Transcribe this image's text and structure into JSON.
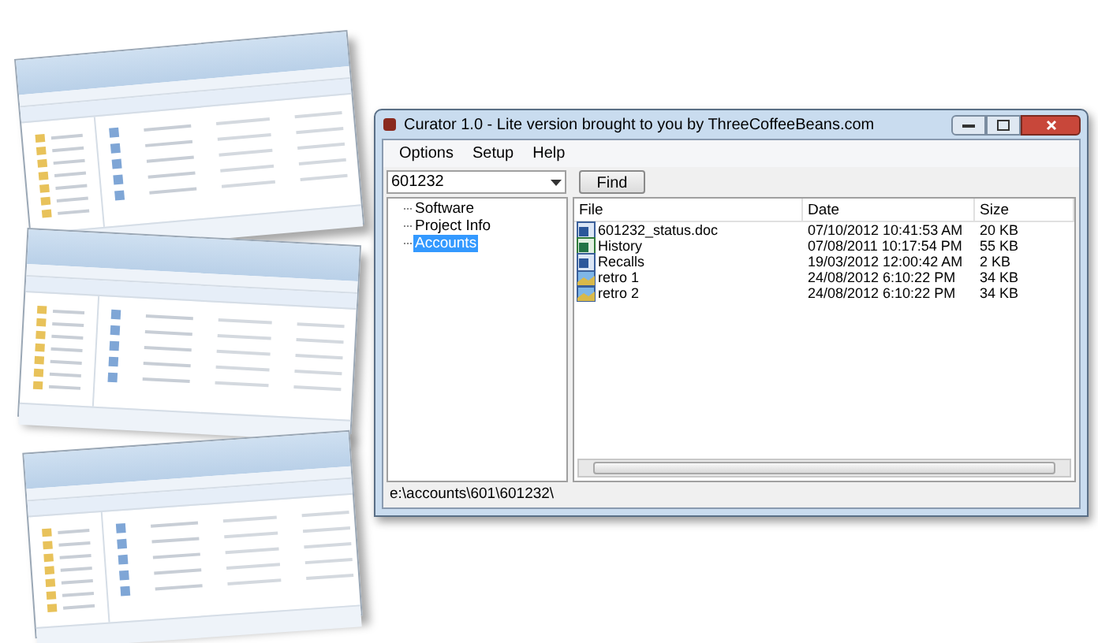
{
  "window": {
    "title": "Curator 1.0 - Lite version brought to you by ThreeCoffeeBeans.com"
  },
  "menu": [
    "Options",
    "Setup",
    "Help"
  ],
  "search": {
    "value": "601232",
    "button": "Find"
  },
  "tree": [
    {
      "label": "Software",
      "selected": false
    },
    {
      "label": "Project Info",
      "selected": false
    },
    {
      "label": "Accounts",
      "selected": true
    }
  ],
  "table": {
    "columns": [
      "File",
      "Date",
      "Size"
    ],
    "rows": [
      {
        "kind": "word",
        "file": "601232_status.doc",
        "date": "07/10/2012 10:41:53 AM",
        "size": "20 KB"
      },
      {
        "kind": "excel",
        "file": "History",
        "date": "07/08/2011 10:17:54 PM",
        "size": "55 KB"
      },
      {
        "kind": "word",
        "file": "Recalls",
        "date": "19/03/2012 12:00:42 AM",
        "size": "2 KB"
      },
      {
        "kind": "image",
        "file": "retro 1",
        "date": "24/08/2012 6:10:22 PM",
        "size": "34 KB"
      },
      {
        "kind": "image",
        "file": "retro 2",
        "date": "24/08/2012 6:10:22 PM",
        "size": "34 KB"
      }
    ]
  },
  "status_bar": "e:\\accounts\\601\\601232\\"
}
